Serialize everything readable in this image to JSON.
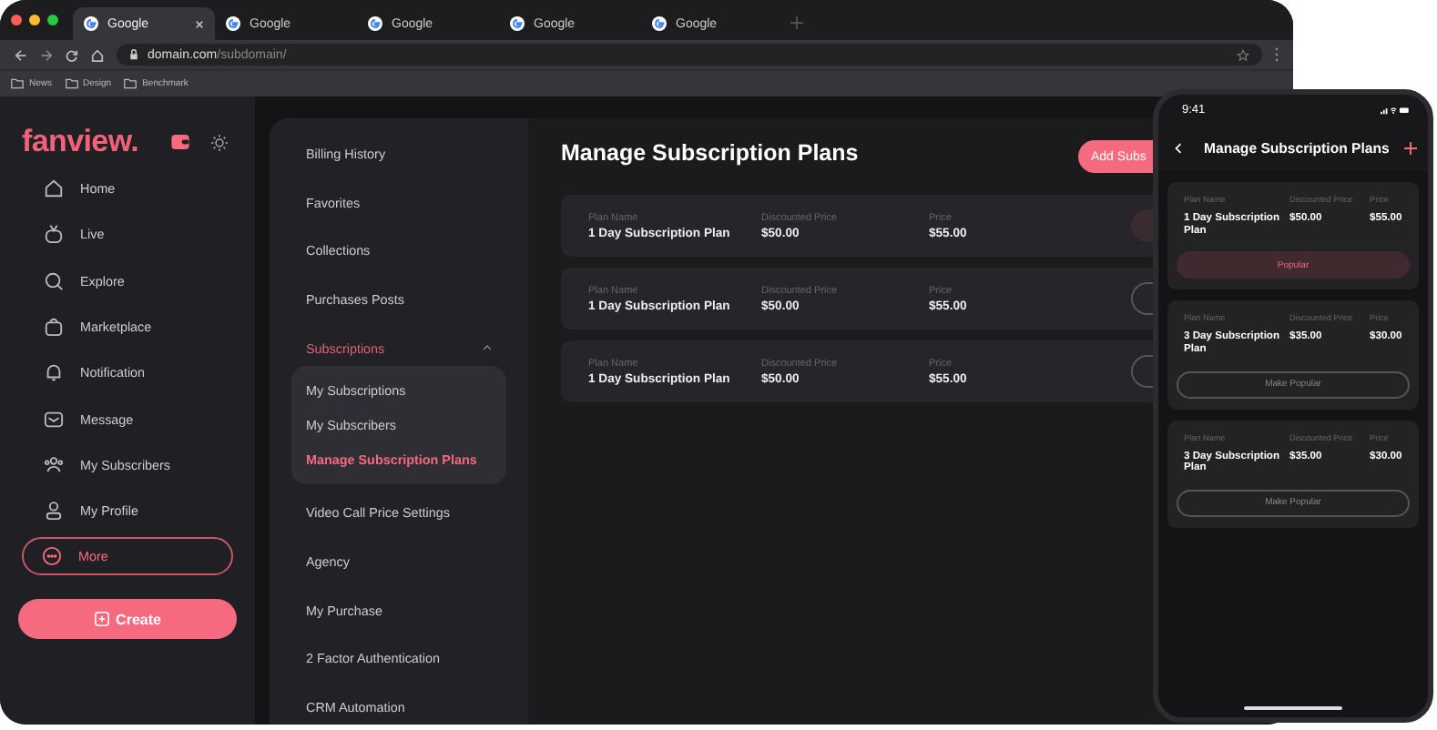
{
  "browser": {
    "tabs": [
      {
        "title": "Google",
        "selected": true
      },
      {
        "title": "Google",
        "selected": false
      },
      {
        "title": "Google",
        "selected": false
      },
      {
        "title": "Google",
        "selected": false
      },
      {
        "title": "Google",
        "selected": false
      }
    ],
    "address": {
      "host": "domain.com",
      "path": "/subdomain/"
    },
    "bookmarks": [
      "News",
      "Design",
      "Benchmark"
    ]
  },
  "sidebar": {
    "logo": "fanview.",
    "nav": [
      {
        "label": "Home",
        "selected": false
      },
      {
        "label": "Live",
        "selected": false
      },
      {
        "label": "Explore",
        "selected": false
      },
      {
        "label": "Marketplace",
        "selected": false
      },
      {
        "label": "Notification",
        "selected": false
      },
      {
        "label": "Message",
        "selected": false
      },
      {
        "label": "My Subscribers",
        "selected": false
      },
      {
        "label": "My Profile",
        "selected": false
      },
      {
        "label": "More",
        "selected": true
      }
    ],
    "create_button": "Create"
  },
  "settings_menu": [
    {
      "label": "Billing History",
      "selected": false
    },
    {
      "label": "Favorites",
      "selected": false
    },
    {
      "label": "Collections",
      "selected": false
    },
    {
      "label": "Purchases Posts",
      "selected": false
    },
    {
      "label": "Subscriptions",
      "selected": true,
      "expanded": true,
      "children": [
        {
          "label": "My Subscriptions",
          "selected": false
        },
        {
          "label": "My Subscribers",
          "selected": false
        },
        {
          "label": "Manage Subscription Plans",
          "selected": true
        }
      ]
    },
    {
      "label": "Video Call Price Settings",
      "selected": false
    },
    {
      "label": "Agency",
      "selected": false
    },
    {
      "label": "My Purchase",
      "selected": false
    },
    {
      "label": "2 Factor Authentication",
      "selected": false
    },
    {
      "label": "CRM Automation",
      "selected": false
    }
  ],
  "main": {
    "title": "Manage Subscription Plans",
    "add_button": "Add Subs",
    "plans": [
      {
        "name_label": "Plan Name",
        "name": "1 Day Subscription Plan",
        "discounted_label": "Discounted Price",
        "discounted": "$50.00",
        "price_label": "Price",
        "price": "$55.00",
        "popular": true
      },
      {
        "name_label": "Plan Name",
        "name": "1 Day Subscription Plan",
        "discounted_label": "Discounted Price",
        "discounted": "$50.00",
        "price_label": "Price",
        "price": "$55.00",
        "popular": false
      },
      {
        "name_label": "Plan Name",
        "name": "1 Day Subscription Plan",
        "discounted_label": "Discounted Price",
        "discounted": "$50.00",
        "price_label": "Price",
        "price": "$55.00",
        "popular": false
      }
    ]
  },
  "phone": {
    "time": "9:41",
    "title": "Manage Subscription Plans",
    "plans": [
      {
        "name_label": "Plan Name",
        "name": "1 Day Subscription Plan",
        "discounted_label": "Discounted Price",
        "discounted": "$50.00",
        "price_label": "Price",
        "price": "$55.00",
        "popular": true,
        "button": "Popular"
      },
      {
        "name_label": "Plan Name",
        "name": "3 Day Subscription Plan",
        "discounted_label": "Discounted Price",
        "discounted": "$35.00",
        "price_label": "Price",
        "price": "$30.00",
        "popular": false,
        "button": "Make Popular"
      },
      {
        "name_label": "Plan Name",
        "name": "3 Day Subscription Plan",
        "discounted_label": "Discounted Price",
        "discounted": "$35.00",
        "price_label": "Price",
        "price": "$30.00",
        "popular": false,
        "button": "Make Popular"
      }
    ]
  }
}
